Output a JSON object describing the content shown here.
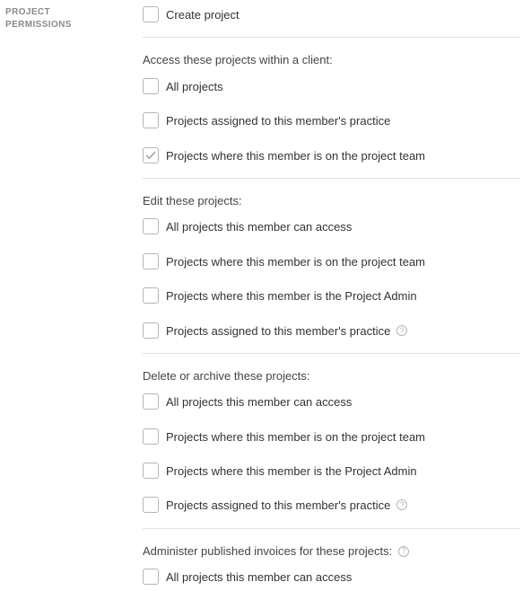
{
  "section": {
    "label_line1": "PROJECT",
    "label_line2": "PERMISSIONS"
  },
  "create_project": {
    "label": "Create project",
    "checked": false
  },
  "access": {
    "heading": "Access these projects within a client:",
    "options": [
      {
        "label": "All projects",
        "checked": false
      },
      {
        "label": "Projects assigned to this member's practice",
        "checked": false
      },
      {
        "label": "Projects where this member is on the project team",
        "checked": true
      }
    ]
  },
  "edit": {
    "heading": "Edit these projects:",
    "options": [
      {
        "label": "All projects this member can access",
        "checked": false
      },
      {
        "label": "Projects where this member is on the project team",
        "checked": false
      },
      {
        "label": "Projects where this member is the Project Admin",
        "checked": false
      },
      {
        "label": "Projects assigned to this member's practice",
        "checked": false
      }
    ],
    "help_glyph": "?"
  },
  "delete": {
    "heading": "Delete or archive these projects:",
    "options": [
      {
        "label": "All projects this member can access",
        "checked": false
      },
      {
        "label": "Projects where this member is on the project team",
        "checked": false
      },
      {
        "label": "Projects where this member is the Project Admin",
        "checked": false
      },
      {
        "label": "Projects assigned to this member's practice",
        "checked": false
      }
    ],
    "help_glyph": "?"
  },
  "invoices": {
    "heading": "Administer published invoices for these projects:",
    "help_glyph": "?",
    "options": [
      {
        "label": "All projects this member can access",
        "checked": false
      }
    ]
  },
  "colors": {
    "check": "#8aa0a8",
    "border": "#b5b5b5",
    "divider": "#e3e3e3",
    "label": "#8a8a8a"
  }
}
